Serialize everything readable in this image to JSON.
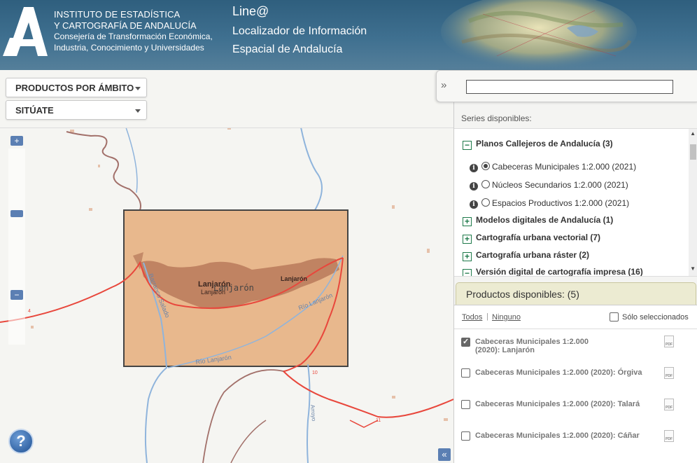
{
  "header": {
    "org_line1": "INSTITUTO DE ESTADÍSTICA",
    "org_line2": "Y CARTOGRAFÍA DE ANDALUCÍA",
    "org_line3": "Consejería de Transformación Económica,",
    "org_line4": "Industria, Conocimiento y Universidades",
    "app_title": "Line@",
    "app_subtitle1": "Localizador de Información",
    "app_subtitle2": "Espacial de Andalucía"
  },
  "toolbar": {
    "productos_label": "PRODUCTOS POR ÁMBITO",
    "situate_label": "SITÚATE"
  },
  "map": {
    "zoom_in": "+",
    "zoom_out": "−",
    "help": "?",
    "collapse": "«",
    "labels": {
      "town_main": "Lanjarón",
      "town_sub": "Lanjarón",
      "town_overlay": "Lanjarón",
      "town_east": "Lanjarón",
      "river_rio_lanjaron_1": "Río Lanjarón",
      "river_rio_lanjaron_2": "Río Lanjarón",
      "barranco": "Barranco Salado",
      "road_10": "10",
      "road_11": "11",
      "road_4": "4",
      "arroyo": "Arroyo"
    },
    "colors": {
      "extent_fill": "#e8b88d",
      "road": "#e8473c",
      "river": "#8fb4dc",
      "contour": "#9e6a5e",
      "town": "#b57658"
    }
  },
  "panel": {
    "toggle": "»",
    "search_placeholder": "",
    "series_label": "Series disponibles:",
    "groups": [
      {
        "label": "Planos Callejeros de Andalucía (3)",
        "expanded": true,
        "icon": "minus"
      },
      {
        "label": "Modelos digitales de Andalucía (1)",
        "expanded": false,
        "icon": "plus"
      },
      {
        "label": "Cartografía urbana vectorial (7)",
        "expanded": false,
        "icon": "plus"
      },
      {
        "label": "Cartografía urbana ráster (2)",
        "expanded": false,
        "icon": "plus"
      },
      {
        "label": "Versión digital de cartografía impresa (16)",
        "expanded": true,
        "icon": "minus"
      }
    ],
    "series": [
      {
        "label": "Cabeceras Municipales 1:2.000 (2021)",
        "selected": true
      },
      {
        "label": "Núcleos Secundarios 1:2.000 (2021)",
        "selected": false
      },
      {
        "label": "Espacios Productivos 1:2.000 (2021)",
        "selected": false
      }
    ],
    "products_header": "Productos disponibles: (5)",
    "link_all": "Todos",
    "link_sep": "|",
    "link_none": "Ninguno",
    "only_selected": "Sólo seleccionados",
    "products": [
      {
        "line1": "Cabeceras Municipales 1:2.000",
        "line2": "(2020): Lanjarón",
        "checked": true
      },
      {
        "line1": "Cabeceras Municipales 1:2.000 (2020): Órgiva",
        "line2": "",
        "checked": false
      },
      {
        "line1": "Cabeceras Municipales 1:2.000 (2020): Talará",
        "line2": "",
        "checked": false
      },
      {
        "line1": "Cabeceras Municipales 1:2.000 (2020): Cáñar",
        "line2": "",
        "checked": false
      }
    ],
    "pdf_label": "PDF"
  }
}
